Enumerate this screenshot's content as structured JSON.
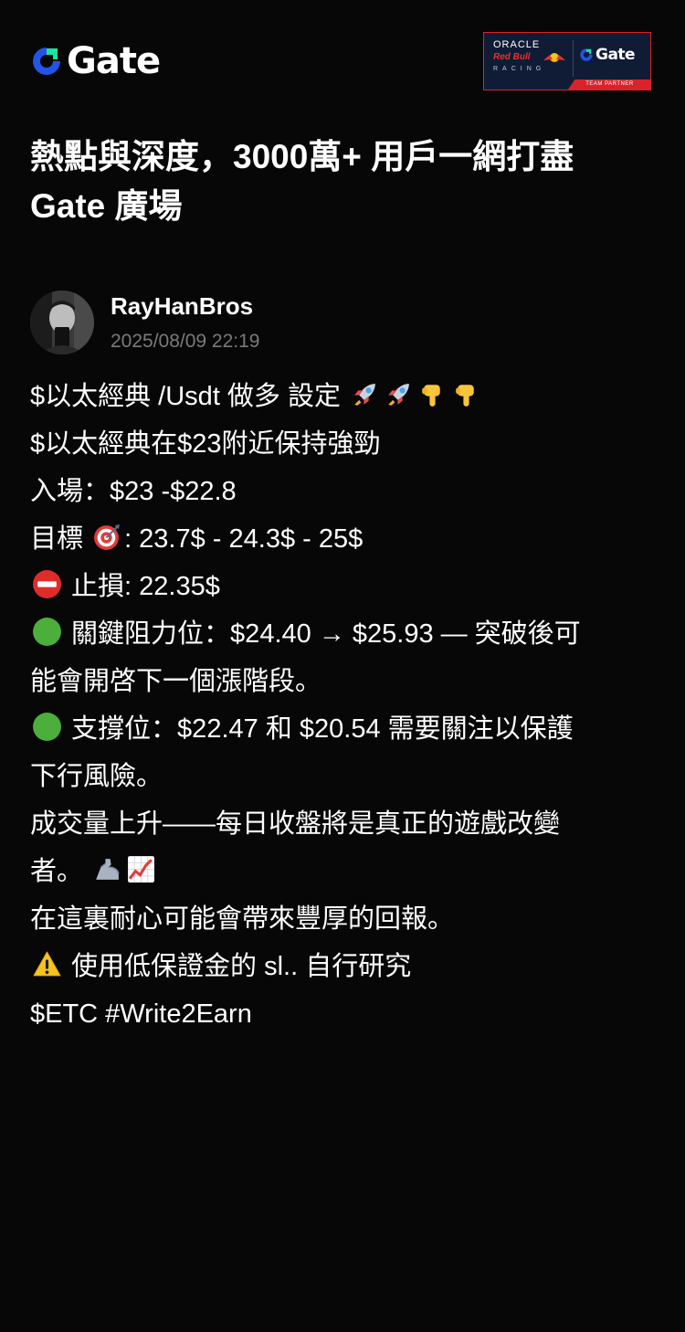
{
  "header": {
    "logo_text": "Gate",
    "partner_badge": {
      "line1": "ORACLE",
      "line2": "Red Bull",
      "line3": "RACING",
      "brand": "Gate",
      "strip": "TEAM PARTNER"
    }
  },
  "headline": {
    "line1": "熱點與深度，3000萬+ 用戶一網打盡",
    "line2": "Gate 廣場"
  },
  "author": {
    "name": "RayHanBros",
    "timestamp": "2025/08/09 22:19"
  },
  "post": {
    "l1_text": "$以太經典 /Usdt 做多 設定 ",
    "l2": "$以太經典在$23附近保持強勁",
    "l3": "入場：$23 -$22.8",
    "l4_a": "目標 ",
    "l4_b": ": 23.7$ - 24.3$ - 25$",
    "l5_b": " 止損: 22.35$",
    "l6_b": " 關鍵阻力位：$24.40 → $25.93 — 突破後可",
    "l7": "能會開啓下一個漲階段。",
    "l8_b": " 支撐位：$22.47 和 $20.54 需要關注以保護",
    "l9": "下行風險。",
    "l10": "成交量上升——每日收盤將是真正的遊戲改變",
    "l11_a": "者。 ",
    "l12": "在這裏耐心可能會帶來豐厚的回報。",
    "l13_b": " 使用低保證金的 sl.. 自行研究",
    "l14": "$ETC #Write2Earn"
  },
  "icons": {
    "l1": [
      "rocket-icon",
      "rocket-icon",
      "pointing-down-icon",
      "pointing-down-icon"
    ],
    "l4": "target-icon",
    "l5": "no-entry-icon",
    "l6": "green-circle-icon",
    "l8": "green-circle-icon",
    "l11": [
      "flexed-biceps-icon",
      "chart-increasing-icon"
    ],
    "l13": "warning-icon"
  },
  "colors": {
    "background": "#070707",
    "text": "#ffffff",
    "muted": "#7a7a7a",
    "gate_blue": "#2354e6",
    "gate_green": "#17e5a0",
    "redbull_red": "#d8232a",
    "badge_navy": "#101c36"
  }
}
